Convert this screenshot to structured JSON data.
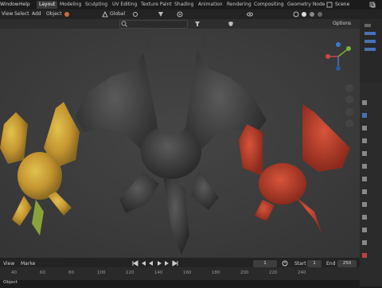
{
  "menubar": {
    "items": [
      "Window",
      "Help"
    ],
    "workspace_tabs": [
      "Layout",
      "Modeling",
      "Sculpting",
      "UV Editing",
      "Texture Paint",
      "Shading",
      "Animation",
      "Rendering",
      "Compositing",
      "Geometry Node"
    ],
    "active_tab": "Layout",
    "scene_label": "Scene"
  },
  "viewport_header": {
    "view": "View",
    "select": "Select",
    "add": "Add",
    "object": "Object",
    "orientation": "Global",
    "options": "Options"
  },
  "timeline": {
    "view": "View",
    "marker": "Marke",
    "current_frame": "1",
    "start_label": "Start",
    "start_value": "1",
    "end_label": "End",
    "end_value": "250",
    "ruler_ticks": [
      "40",
      "60",
      "80",
      "100",
      "120",
      "140",
      "160",
      "180",
      "200",
      "220",
      "240"
    ]
  },
  "statusbar": {
    "text": "Object"
  },
  "colors": {
    "viewport_bg": "#3a3a3a",
    "dragon_dark": "#3d3d3d",
    "dragon_yellow": "#c8a33a",
    "dragon_red": "#b8402c",
    "accent": "#4772b3"
  }
}
